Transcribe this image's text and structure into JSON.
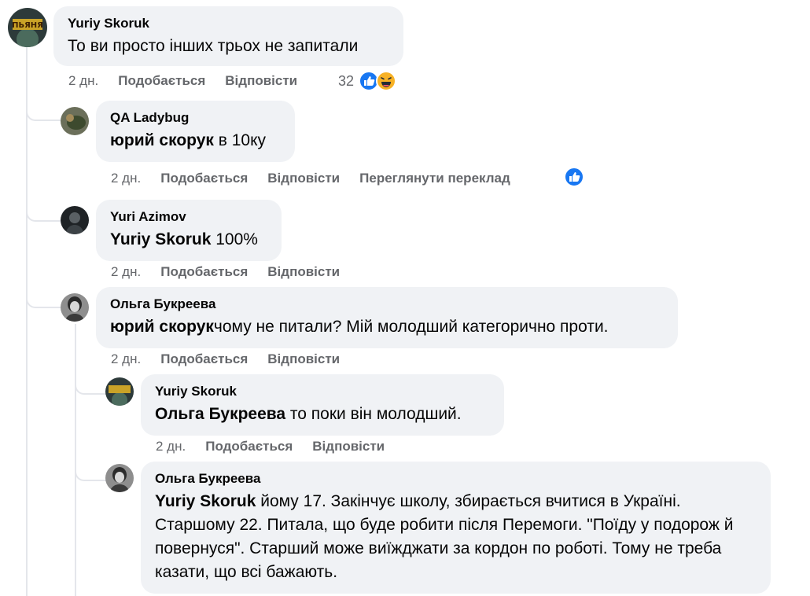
{
  "comments": [
    {
      "author": "Yuriy Skoruk",
      "mention": "",
      "text": "То ви просто інших трьох не запитали",
      "time": "2 дн.",
      "like": "Подобається",
      "reply": "Відповісти",
      "reactions": "32"
    },
    {
      "author": "QA Ladybug",
      "mention": "юрий скорук",
      "text": " в 10ку",
      "time": "2 дн.",
      "like": "Подобається",
      "reply": "Відповісти",
      "translate": "Переглянути переклад"
    },
    {
      "author": "Yuri Azimov",
      "mention": "Yuriy Skoruk",
      "text": " 100%",
      "time": "2 дн.",
      "like": "Подобається",
      "reply": "Відповісти"
    },
    {
      "author": "Ольга Букреева",
      "mention": "юрий скорук",
      "text": "чому не питали? Мій молодший категорично проти.",
      "time": "2 дн.",
      "like": "Подобається",
      "reply": "Відповісти"
    },
    {
      "author": "Yuriy Skoruk",
      "mention": "Ольга Букреева",
      "text": " то поки він молодший.",
      "time": "2 дн.",
      "like": "Подобається",
      "reply": "Відповісти"
    },
    {
      "author": "Ольга Букреева",
      "mention": "Yuriy Skoruk",
      "text": " йому 17. Закінчує школу, збирається вчитися в Україні. Старшому 22. Питала, що буде робити після Перемоги. \"Поїду у подорож й повернуся\". Старший може виїжджати за кордон по роботі. Тому не треба казати, що всі бажають."
    }
  ],
  "avatar_logo_text": "ПЬЯНЯ",
  "colors": {
    "like_blue": "#1877f2",
    "haha_yellow": "#f7b125",
    "bubble_bg": "#f0f2f5",
    "muted": "#65676b"
  }
}
